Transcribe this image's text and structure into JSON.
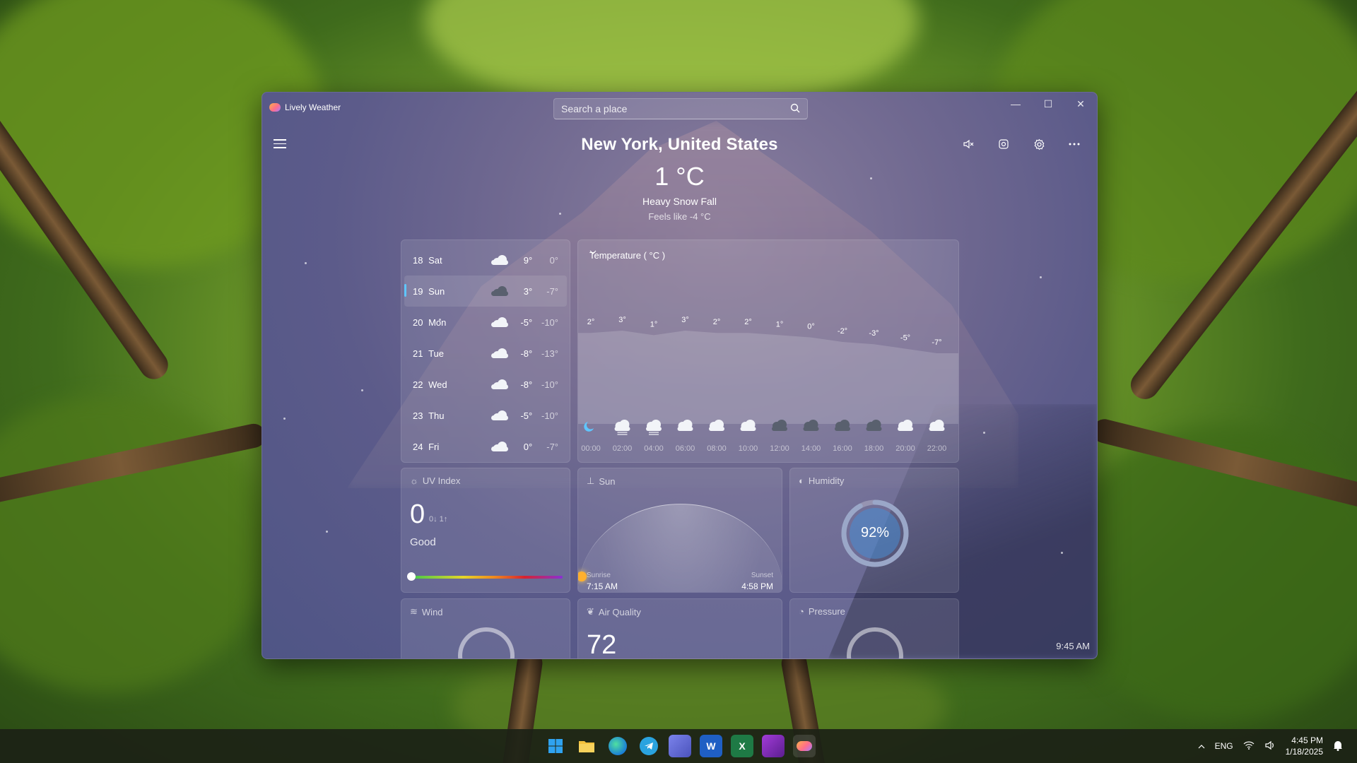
{
  "app": {
    "title": "Lively Weather"
  },
  "search": {
    "placeholder": "Search a place"
  },
  "window_controls": {
    "minimize": "—",
    "maximize": "☐",
    "close": "✕"
  },
  "header": {
    "location": "New York, United States",
    "temperature": "1 °C",
    "condition": "Heavy Snow Fall",
    "feels_like": "Feels like -4 °C"
  },
  "toolbar": [
    "mute-icon",
    "image-icon",
    "gear-icon",
    "more-icon"
  ],
  "forecast": [
    {
      "date": "18",
      "day": "Sat",
      "icon": "cloud",
      "hi": "9°",
      "lo": "0°"
    },
    {
      "date": "19",
      "day": "Sun",
      "icon": "dark-cloud",
      "hi": "3°",
      "lo": "-7°"
    },
    {
      "date": "20",
      "day": "Mon",
      "icon": "cloud",
      "hi": "-5°",
      "lo": "-10°"
    },
    {
      "date": "21",
      "day": "Tue",
      "icon": "cloud",
      "hi": "-8°",
      "lo": "-13°"
    },
    {
      "date": "22",
      "day": "Wed",
      "icon": "cloud",
      "hi": "-8°",
      "lo": "-10°"
    },
    {
      "date": "23",
      "day": "Thu",
      "icon": "cloud",
      "hi": "-5°",
      "lo": "-10°"
    },
    {
      "date": "24",
      "day": "Fri",
      "icon": "cloud",
      "hi": "0°",
      "lo": "-7°"
    }
  ],
  "chart": {
    "selector": "Temperature ( °C )",
    "icons": [
      "moon",
      "snow",
      "snow",
      "cloud",
      "cloud",
      "cloud",
      "dark-cloud",
      "dark-cloud",
      "dark-cloud",
      "dark-cloud",
      "cloud",
      "cloud"
    ]
  },
  "chart_data": {
    "type": "area",
    "x": [
      "00:00",
      "02:00",
      "04:00",
      "06:00",
      "08:00",
      "10:00",
      "12:00",
      "14:00",
      "16:00",
      "18:00",
      "20:00",
      "22:00"
    ],
    "values": [
      2,
      3,
      1,
      3,
      2,
      2,
      1,
      0,
      -2,
      -3,
      -5,
      -7
    ],
    "value_labels": [
      "2°",
      "3°",
      "1°",
      "3°",
      "2°",
      "2°",
      "1°",
      "0°",
      "-2°",
      "-3°",
      "-5°",
      "-7°"
    ],
    "ylabel": "Temperature ( °C )"
  },
  "uv": {
    "title": "UV Index",
    "value": "0",
    "range": "0↓ 1↑",
    "level": "Good"
  },
  "sun": {
    "title": "Sun",
    "sunrise_label": "Sunrise",
    "sunrise_time": "7:15 AM",
    "sunset_label": "Sunset",
    "sunset_time": "4:58 PM"
  },
  "humidity": {
    "title": "Humidity",
    "value": "92%",
    "percent": 92
  },
  "wind": {
    "title": "Wind"
  },
  "air_quality": {
    "title": "Air Quality",
    "value": "72"
  },
  "pressure": {
    "title": "Pressure"
  },
  "status_time": "9:45 AM",
  "taskbar": {
    "apps": [
      "windows-start",
      "file-explorer",
      "edge",
      "telegram",
      "teams",
      "word",
      "excel",
      "affinity",
      "lively-weather"
    ],
    "lang": "ENG",
    "time": "4:45 PM",
    "date": "1/18/2025"
  }
}
